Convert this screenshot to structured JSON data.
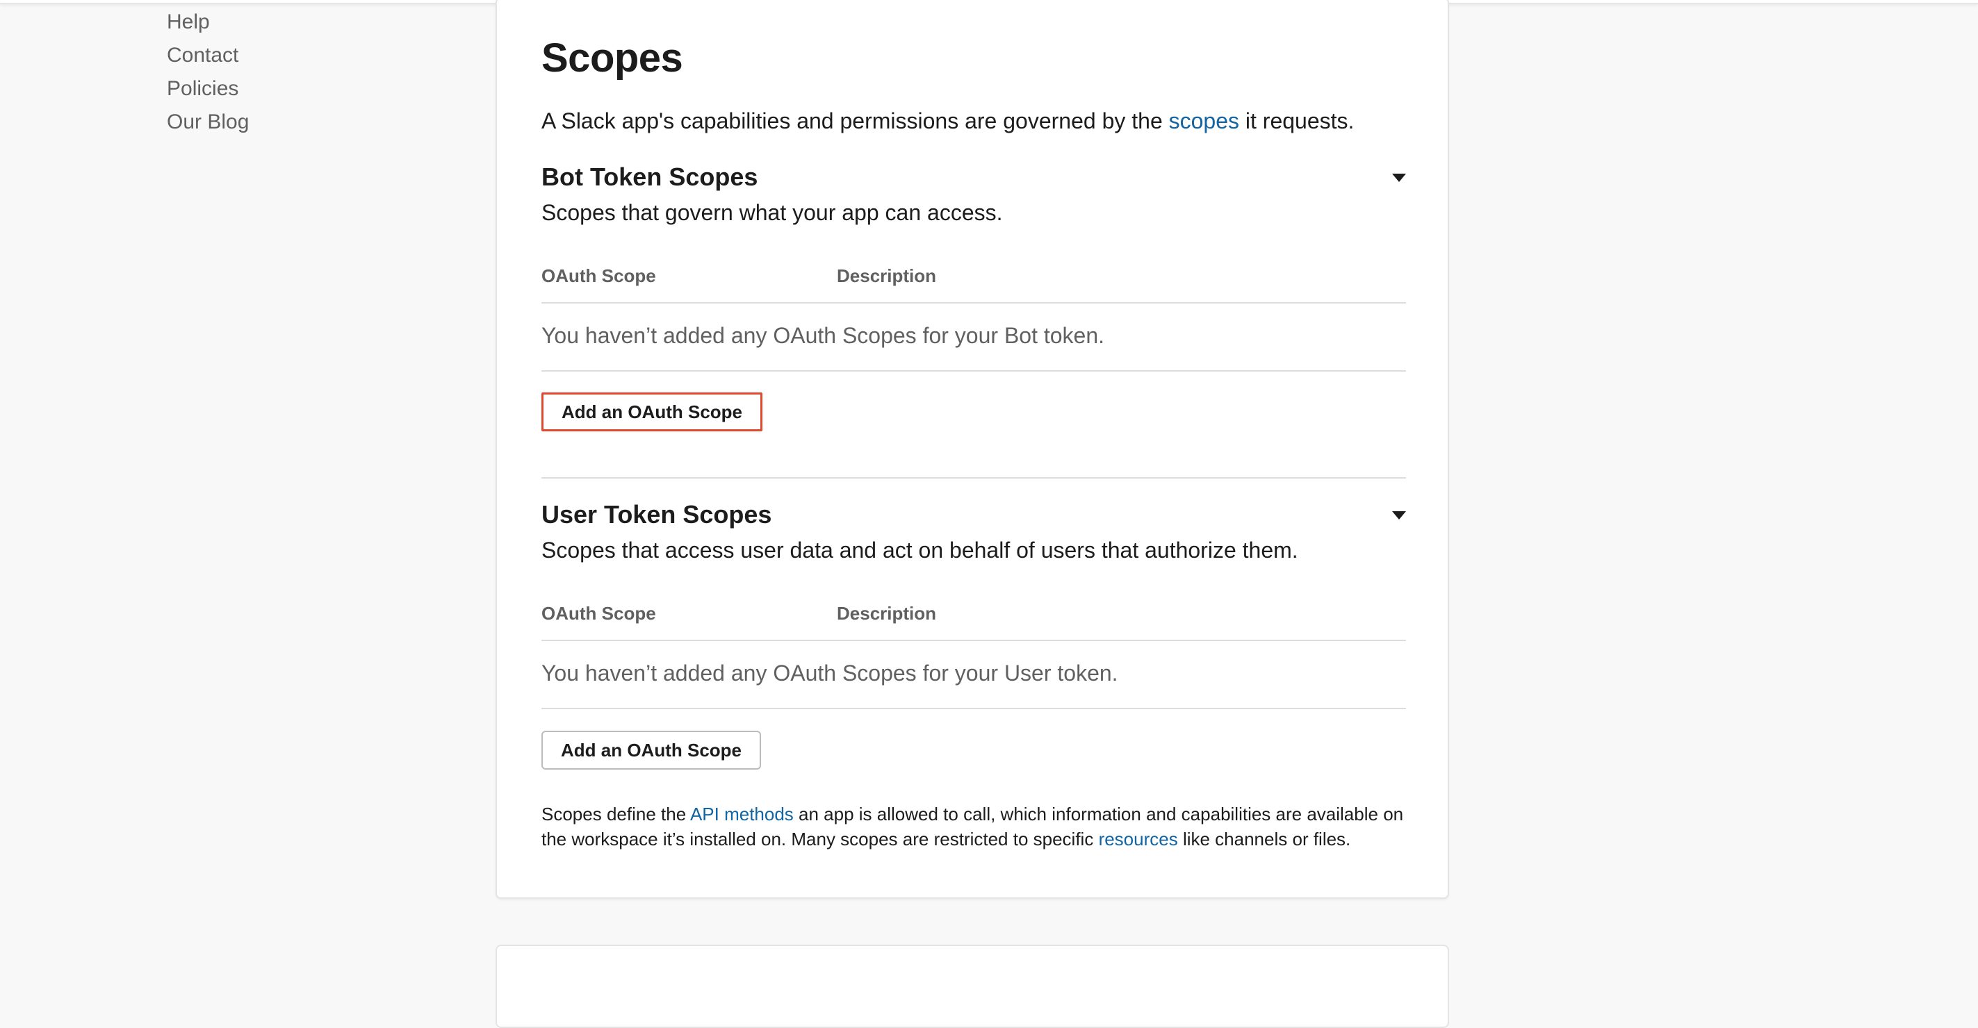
{
  "sidebar": {
    "links": [
      "Help",
      "Contact",
      "Policies",
      "Our Blog"
    ]
  },
  "scopes": {
    "title": "Scopes",
    "intro_before": "A Slack app's capabilities and permissions are governed by the ",
    "intro_link": "scopes",
    "intro_after": " it requests."
  },
  "bot": {
    "title": "Bot Token Scopes",
    "description": "Scopes that govern what your app can access.",
    "col_scope": "OAuth Scope",
    "col_description": "Description",
    "empty": "You haven’t added any OAuth Scopes for your Bot token.",
    "button": "Add an OAuth Scope"
  },
  "user": {
    "title": "User Token Scopes",
    "description": "Scopes that access user data and act on behalf of users that authorize them.",
    "col_scope": "OAuth Scope",
    "col_description": "Description",
    "empty": "You haven’t added any OAuth Scopes for your User token.",
    "button": "Add an OAuth Scope"
  },
  "footnote": {
    "part1": "Scopes define the ",
    "link1": "API methods",
    "part2": " an app is allowed to call, which information and capabilities are available on the workspace it’s installed on. Many scopes are restricted to specific ",
    "link2": "resources",
    "part3": " like channels or files."
  },
  "colors": {
    "link": "#1264a3",
    "focus_outline": "#e0492f",
    "background": "#f8f8f8"
  }
}
